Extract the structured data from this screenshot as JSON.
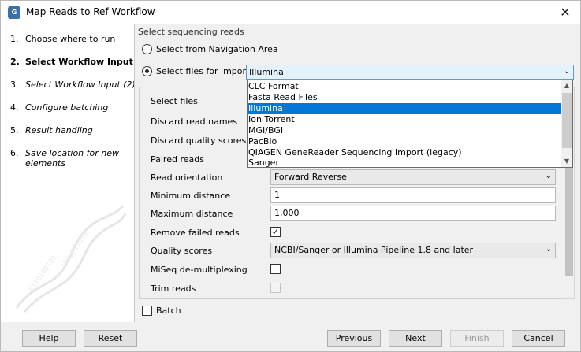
{
  "window": {
    "title": "Map Reads to Ref Workflow",
    "icon": "clc-app-icon",
    "close": "✕"
  },
  "sidebar": {
    "steps": [
      {
        "num": "1.",
        "label": "Choose where to run"
      },
      {
        "num": "2.",
        "label": "Select Workflow Input"
      },
      {
        "num": "3.",
        "label": "Select Workflow Input (2)"
      },
      {
        "num": "4.",
        "label": "Configure batching"
      },
      {
        "num": "5.",
        "label": "Result handling"
      },
      {
        "num": "6.",
        "label": "Save location for new",
        "label2": "elements"
      }
    ]
  },
  "main": {
    "section_title": "Select sequencing reads",
    "radio_navigation": "Select from Navigation Area",
    "radio_import": "Select files for import:",
    "import_combo_value": "Illumina",
    "fields": {
      "select_files": "Select files",
      "discard_names": "Discard read names",
      "discard_quality": "Discard quality scores",
      "paired_reads": "Paired reads",
      "read_orientation": "Read orientation",
      "read_orientation_value": "Forward Reverse",
      "min_distance": "Minimum distance",
      "min_distance_value": "1",
      "max_distance": "Maximum distance",
      "max_distance_value": "1,000",
      "remove_failed": "Remove failed reads",
      "remove_failed_checked": "✓",
      "quality_scores": "Quality scores",
      "quality_scores_value": "NCBI/Sanger or Illumina Pipeline 1.8 and later",
      "miseq_demux": "MiSeq de-multiplexing",
      "trim_reads": "Trim reads"
    },
    "batch_label": "Batch"
  },
  "dropdown": {
    "options": [
      "CLC Format",
      "Fasta Read Files",
      "Illumina",
      "Ion Torrent",
      "MGI/BGI",
      "PacBio",
      "QIAGEN GeneReader Sequencing Import (legacy)",
      "Sanger"
    ],
    "selected": "Illumina"
  },
  "footer": {
    "help": "Help",
    "reset": "Reset",
    "previous": "Previous",
    "next": "Next",
    "finish": "Finish",
    "cancel": "Cancel"
  }
}
